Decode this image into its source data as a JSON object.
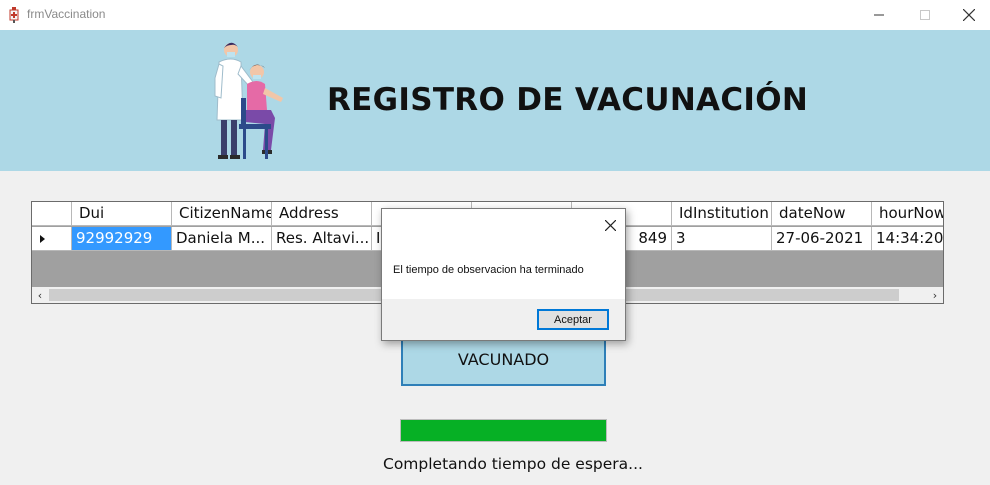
{
  "window": {
    "title": "frmVaccination"
  },
  "banner": {
    "title": "REGISTRO DE VACUNACIÓN",
    "illustration": "nurse-vaccinating-patient-icon",
    "background": "#add8e6"
  },
  "grid": {
    "columns": [
      "Dui",
      "CitizenName",
      "Address",
      "",
      "",
      "",
      "IdInstitution",
      "dateNow",
      "hourNow"
    ],
    "rows": [
      [
        "92992929",
        "Daniela M...",
        "Res. Altavi...",
        "I",
        "",
        "849",
        "3",
        "27-06-2021",
        "14:34:20"
      ]
    ],
    "selected_color": "#3399ff"
  },
  "button": {
    "label": "VACUNADO"
  },
  "progress": {
    "value": 100,
    "color": "#06b025"
  },
  "status": {
    "text": "Completando tiempo de espera..."
  },
  "dialog": {
    "message": "El tiempo de observacion ha terminado",
    "ok_label": "Aceptar"
  }
}
